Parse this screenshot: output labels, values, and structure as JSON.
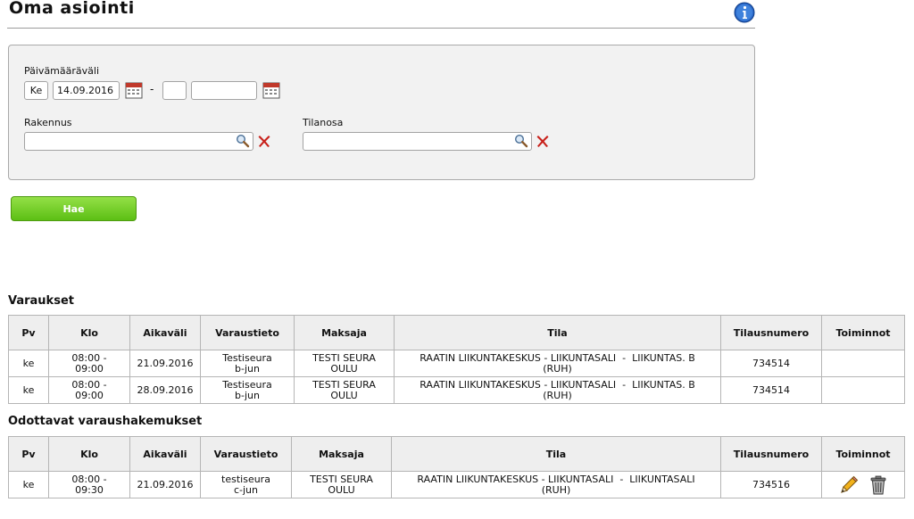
{
  "page": {
    "title": "Oma asiointi"
  },
  "filters": {
    "date_range_label": "Päivämääräväli",
    "day_value": "Ke",
    "start_date": "14.09.2016",
    "range_separator": "-",
    "end_day_value": "",
    "end_date": "",
    "building_label": "Rakennus",
    "building_value": "",
    "space_part_label": "Tilanosa",
    "space_part_value": ""
  },
  "search_button": "Hae",
  "reservations": {
    "title": "Varaukset",
    "headers": [
      "Pv",
      "Klo",
      "Aikaväli",
      "Varaustieto",
      "Maksaja",
      "Tila",
      "Tilausnumero",
      "Toiminnot"
    ],
    "rows": [
      {
        "pv": "ke",
        "klo1": "08:00 -",
        "klo2": "09:00",
        "aikavali": "21.09.2016",
        "tieto1": "Testiseura",
        "tieto2": "b-jun",
        "maksaja1": "TESTI SEURA",
        "maksaja2": "OULU",
        "tila1": "RAATIN LIIKUNTAKESKUS - LIIKUNTASALI  -  LIIKUNTAS. B",
        "tila2": "(RUH)",
        "tilausnumero": "734514"
      },
      {
        "pv": "ke",
        "klo1": "08:00 -",
        "klo2": "09:00",
        "aikavali": "28.09.2016",
        "tieto1": "Testiseura",
        "tieto2": "b-jun",
        "maksaja1": "TESTI SEURA",
        "maksaja2": "OULU",
        "tila1": "RAATIN LIIKUNTAKESKUS - LIIKUNTASALI  -  LIIKUNTAS. B",
        "tila2": "(RUH)",
        "tilausnumero": "734514"
      }
    ]
  },
  "pending": {
    "title": "Odottavat varaushakemukset",
    "headers": [
      "Pv",
      "Klo",
      "Aikaväli",
      "Varaustieto",
      "Maksaja",
      "Tila",
      "Tilausnumero",
      "Toiminnot"
    ],
    "rows": [
      {
        "pv": "ke",
        "klo1": "08:00 -",
        "klo2": "09:30",
        "aikavali": "21.09.2016",
        "tieto1": "testiseura",
        "tieto2": "c-jun",
        "maksaja1": "TESTI SEURA",
        "maksaja2": "OULU",
        "tila1": "RAATIN LIIKUNTAKESKUS - LIIKUNTASALI  -  LIIKUNTASALI",
        "tila2": "(RUH)",
        "tilausnumero": "734516",
        "actions": [
          "edit-pencil-icon",
          "delete-trash-icon"
        ]
      }
    ]
  },
  "icons": {
    "info": "info-icon",
    "calendar": "calendar-icon",
    "search": "magnifier-icon",
    "clear": "red-x-icon"
  },
  "colors": {
    "button_green": "#5cbf14",
    "info_blue": "#1f5fbf",
    "clear_red": "#c8201a"
  }
}
